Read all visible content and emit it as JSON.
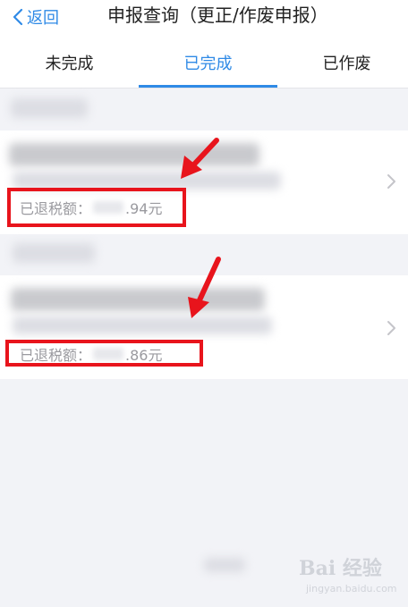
{
  "nav": {
    "back_label": "返回",
    "title": "申报查询（更正/作废申报）"
  },
  "tabs": [
    {
      "label": "未完成",
      "active": false
    },
    {
      "label": "已完成",
      "active": true
    },
    {
      "label": "已作废",
      "active": false
    }
  ],
  "records": [
    {
      "refund_label": "已退税额：",
      "refund_amount_visible": ".94元"
    },
    {
      "refund_label": "已退税额：",
      "refund_amount_visible": ".86元"
    }
  ],
  "watermark": {
    "logo_text": "Bai 经验",
    "url": "jingyan.baidu.com"
  },
  "colors": {
    "accent": "#2f8ae6",
    "highlight_red": "#e8141c",
    "background": "#f2f3f7"
  }
}
